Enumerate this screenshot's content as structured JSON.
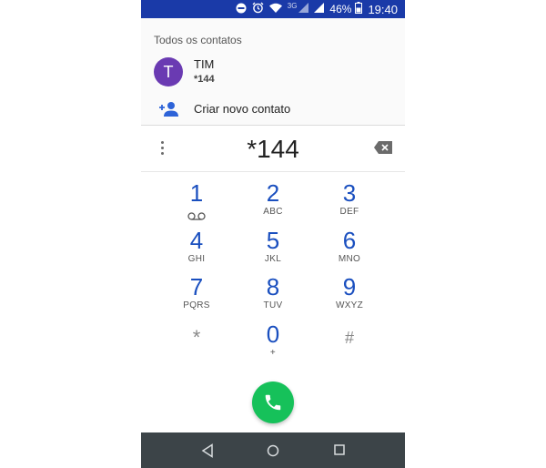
{
  "status": {
    "network": "3G",
    "battery": "46%",
    "time": "19:40"
  },
  "contacts": {
    "section_title": "Todos os contatos",
    "entries": [
      {
        "initial": "T",
        "name": "TIM",
        "number": "*144"
      }
    ],
    "new_contact_label": "Criar novo contato"
  },
  "dialer": {
    "digits": "*144",
    "keys": [
      {
        "digit": "1",
        "letters": ""
      },
      {
        "digit": "2",
        "letters": "ABC"
      },
      {
        "digit": "3",
        "letters": "DEF"
      },
      {
        "digit": "4",
        "letters": "GHI"
      },
      {
        "digit": "5",
        "letters": "JKL"
      },
      {
        "digit": "6",
        "letters": "MNO"
      },
      {
        "digit": "7",
        "letters": "PQRS"
      },
      {
        "digit": "8",
        "letters": "TUV"
      },
      {
        "digit": "9",
        "letters": "WXYZ"
      },
      {
        "digit": "*",
        "letters": ""
      },
      {
        "digit": "0",
        "letters": "+"
      },
      {
        "digit": "#",
        "letters": ""
      }
    ]
  },
  "colors": {
    "status_bar": "#1a3aa8",
    "avatar": "#6a3ab2",
    "digit_blue": "#1a4fbf",
    "call_green": "#16c15a",
    "nav_bar": "#3c4448"
  },
  "icons": {
    "status": [
      "do-not-disturb-icon",
      "alarm-icon",
      "wifi-icon",
      "signal-icon",
      "battery-icon"
    ],
    "dialer": [
      "overflow-menu-icon",
      "backspace-icon",
      "voicemail-icon",
      "phone-icon"
    ],
    "nav": [
      "back-icon",
      "home-icon",
      "recents-icon"
    ]
  }
}
